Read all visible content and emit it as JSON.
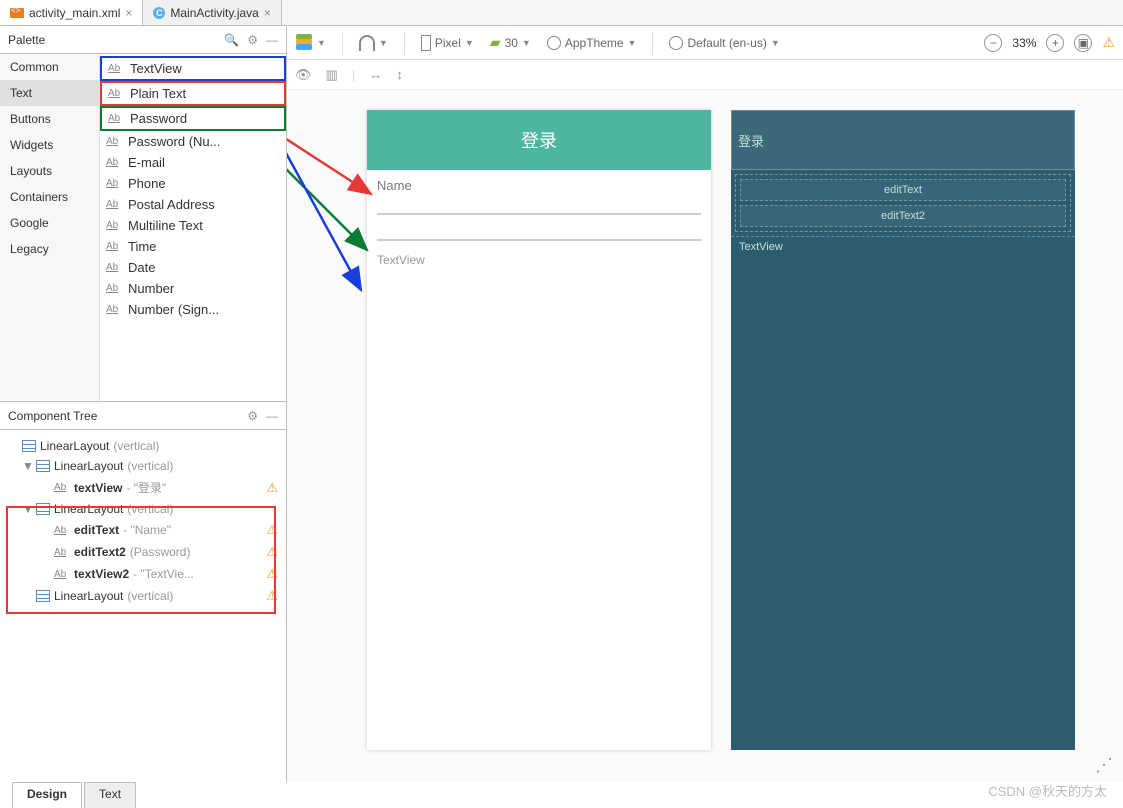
{
  "tabs": {
    "editor1": "activity_main.xml",
    "editor2": "MainActivity.java"
  },
  "palette": {
    "title": "Palette",
    "categories": [
      "Common",
      "Text",
      "Buttons",
      "Widgets",
      "Layouts",
      "Containers",
      "Google",
      "Legacy"
    ],
    "selected_category": "Text",
    "items": [
      "TextView",
      "Plain Text",
      "Password",
      "Password (Nu...",
      "E-mail",
      "Phone",
      "Postal Address",
      "Multiline Text",
      "Time",
      "Date",
      "Number",
      "Number (Sign..."
    ]
  },
  "tree": {
    "title": "Component Tree",
    "root": {
      "name": "LinearLayout",
      "variant": "(vertical)"
    },
    "child1": {
      "name": "LinearLayout",
      "variant": "(vertical)"
    },
    "tv1": {
      "name": "textView",
      "suffix": "- \"登录\""
    },
    "child2": {
      "name": "LinearLayout",
      "variant": "(vertical)"
    },
    "et1": {
      "name": "editText",
      "suffix": "- \"Name\""
    },
    "et2": {
      "name": "editText2",
      "suffix": "(Password)"
    },
    "tv2": {
      "name": "textView2",
      "suffix": "- \"TextVie..."
    },
    "child3": {
      "name": "LinearLayout",
      "variant": "(vertical)"
    }
  },
  "toolbar": {
    "device": "Pixel",
    "api": "30",
    "theme": "AppTheme",
    "locale": "Default (en-us)",
    "zoom": "33%"
  },
  "preview": {
    "title": "登录",
    "hint1": "Name",
    "textview_label": "TextView"
  },
  "blueprint": {
    "bar": "登录",
    "row1": "editText",
    "row2": "editText2",
    "tv": "TextView"
  },
  "bottom": {
    "design": "Design",
    "text": "Text"
  },
  "watermark": "CSDN @秋天的方太",
  "icons": {
    "search": "🔍",
    "gear": "⚙",
    "minus": "—",
    "warn": "⚠"
  }
}
